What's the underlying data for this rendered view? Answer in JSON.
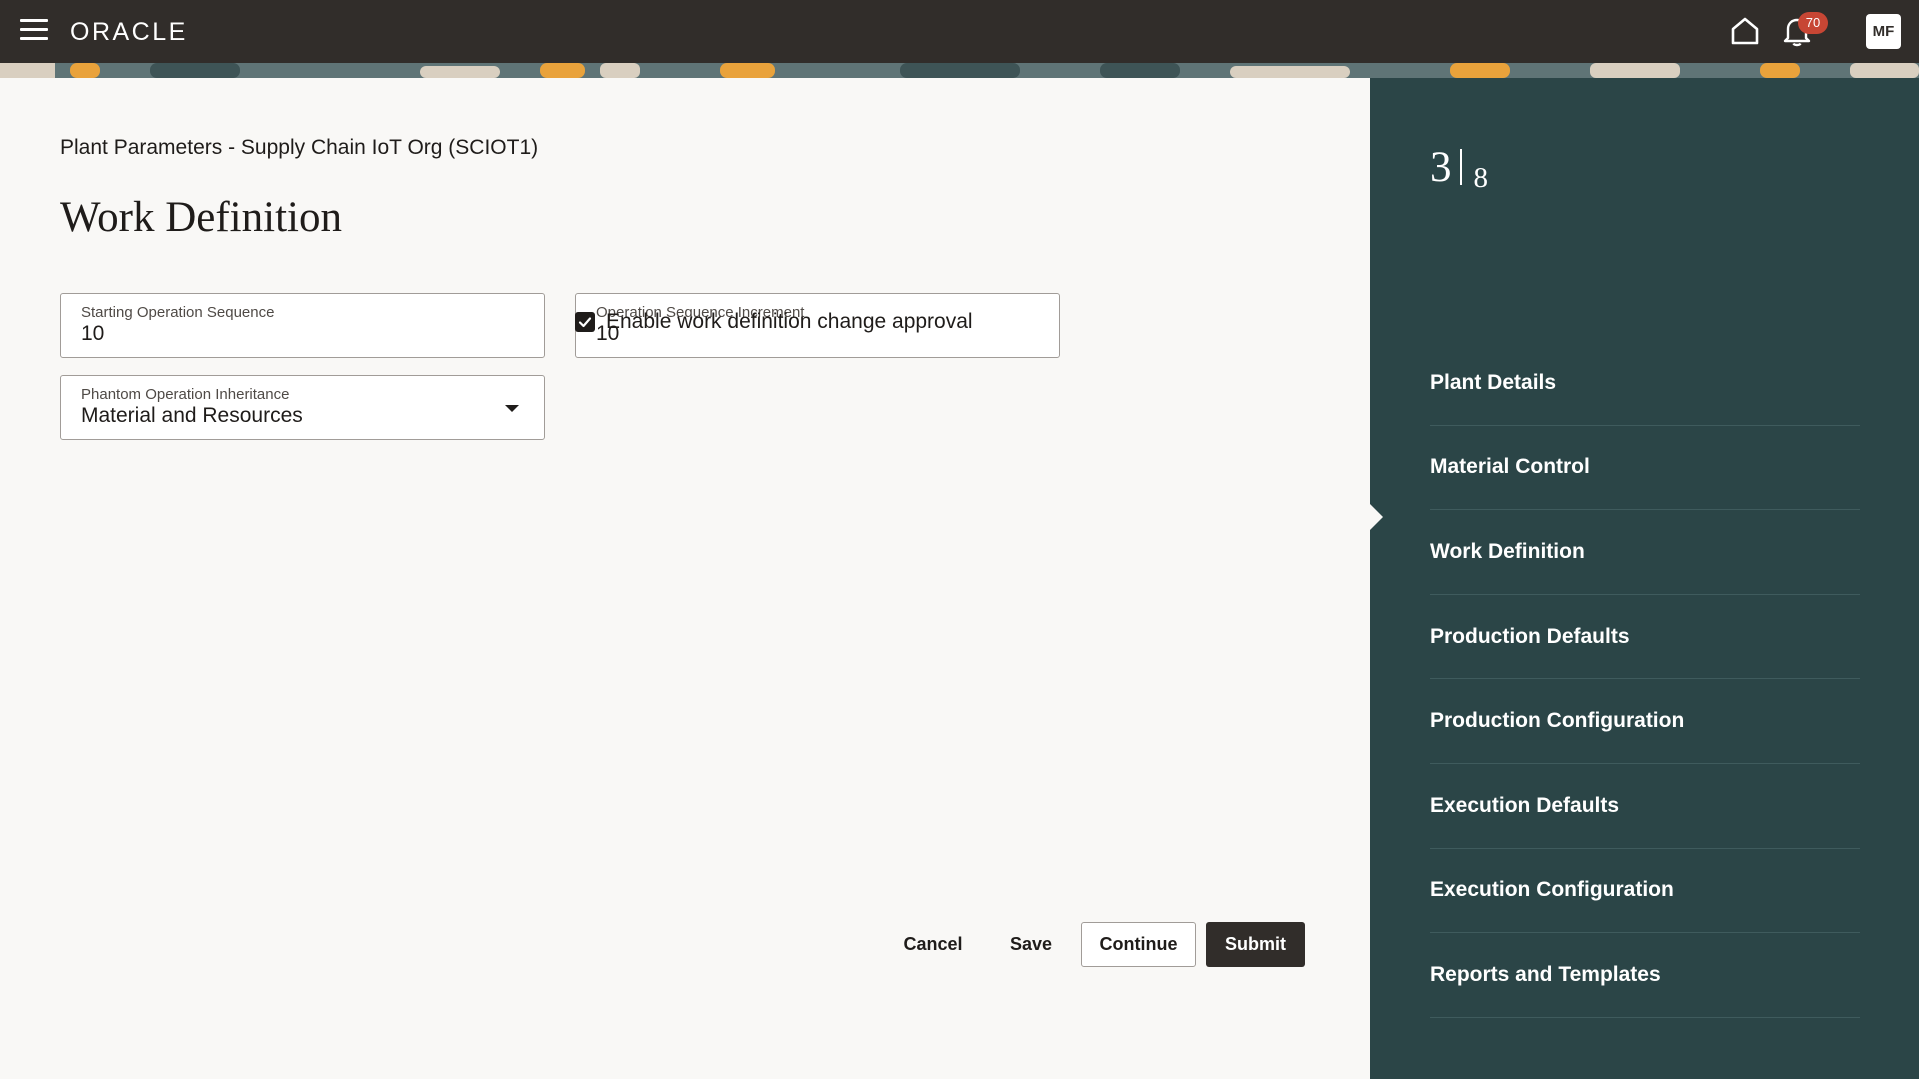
{
  "header": {
    "logo_text": "ORACLE",
    "notification_count": "70",
    "user_initials": "MF",
    "icons": [
      "hamburger-menu-icon",
      "home-icon",
      "bell-icon"
    ]
  },
  "page": {
    "breadcrumb": "Plant Parameters - Supply Chain IoT Org (SCIOT1)",
    "title": "Work Definition"
  },
  "form": {
    "starting_operation_sequence": {
      "label": "Starting Operation Sequence",
      "value": "10"
    },
    "operation_sequence_increment": {
      "label": "Operation Sequence Increment",
      "value": "10"
    },
    "phantom_operation_inheritance": {
      "label": "Phantom Operation Inheritance",
      "value": "Material and Resources"
    },
    "enable_approval": {
      "label": "Enable work definition change approval",
      "checked": true
    }
  },
  "buttons": {
    "cancel": "Cancel",
    "save": "Save",
    "continue": "Continue",
    "submit": "Submit"
  },
  "train": {
    "current_step": "3",
    "total_steps": "8",
    "steps": [
      {
        "label": "Plant Details"
      },
      {
        "label": "Material Control"
      },
      {
        "label": "Work Definition",
        "current": true
      },
      {
        "label": "Production Defaults"
      },
      {
        "label": "Production Configuration"
      },
      {
        "label": "Execution Defaults"
      },
      {
        "label": "Execution Configuration"
      },
      {
        "label": "Reports and Templates"
      }
    ]
  },
  "colors": {
    "header_bg": "#312d2a",
    "panel_bg": "#2b4547",
    "badge": "#c74634",
    "page_bg": "#f9f8f6"
  }
}
